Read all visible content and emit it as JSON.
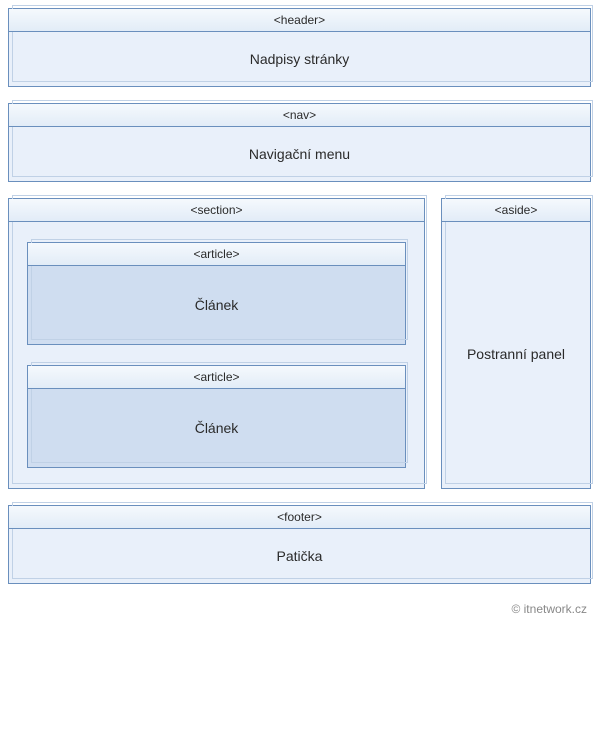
{
  "header": {
    "tag": "<header>",
    "label": "Nadpisy stránky"
  },
  "nav": {
    "tag": "<nav>",
    "label": "Navigační menu"
  },
  "section": {
    "tag": "<section>",
    "articles": [
      {
        "tag": "<article>",
        "label": "Článek"
      },
      {
        "tag": "<article>",
        "label": "Článek"
      }
    ]
  },
  "aside": {
    "tag": "<aside>",
    "label": "Postranní panel"
  },
  "footer": {
    "tag": "<footer>",
    "label": "Patička"
  },
  "attribution": "© itnetwork.cz"
}
